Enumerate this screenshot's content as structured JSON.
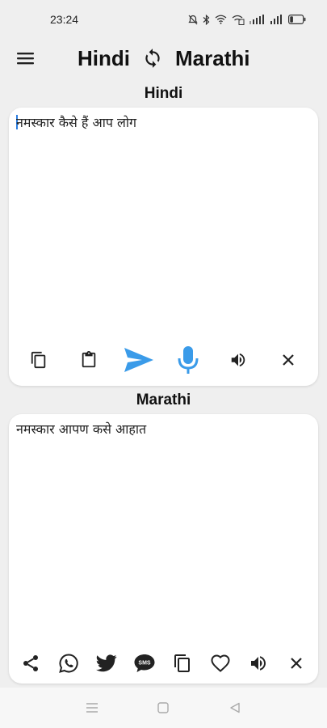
{
  "status_bar": {
    "time": "23:24",
    "battery_level": 0.25
  },
  "toolbar": {
    "source_lang": "Hindi",
    "target_lang": "Marathi",
    "menu_icon": "hamburger-menu-icon",
    "swap_icon": "swap-languages-icon"
  },
  "source": {
    "label": "Hindi",
    "text": "नमस्कार कैसे हैं आप लोग",
    "actions": [
      "copy-icon",
      "paste-icon",
      "send-icon",
      "microphone-icon",
      "speaker-icon",
      "clear-icon"
    ]
  },
  "target": {
    "label": "Marathi",
    "text": "नमस्कार आपण कसे आहात",
    "actions": [
      "share-icon",
      "whatsapp-icon",
      "twitter-icon",
      "sms-icon",
      "copy-icon",
      "favorite-icon",
      "speaker-icon",
      "clear-icon"
    ]
  },
  "colors": {
    "accent": "#3a9be9",
    "background": "#efefef",
    "card": "#ffffff"
  }
}
